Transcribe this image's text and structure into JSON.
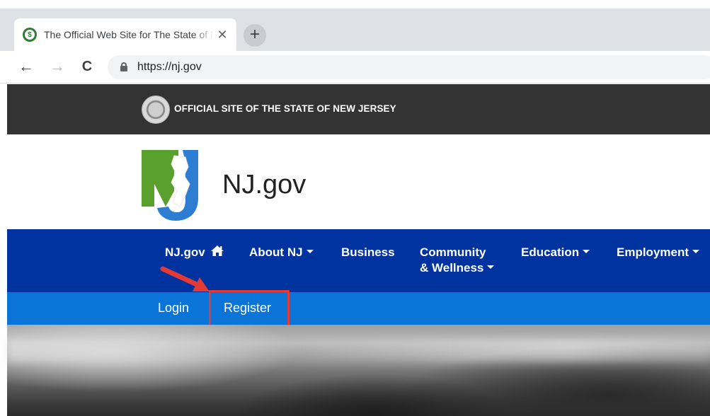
{
  "browser": {
    "tab_title": "The Official Web Site for The State of New Jersey",
    "tab_close": "✕",
    "new_tab": "+",
    "url": "https://nj.gov",
    "back": "←",
    "forward": "→",
    "reload": "C"
  },
  "official_bar": {
    "text": "OFFICIAL SITE OF THE STATE OF NEW JERSEY"
  },
  "header": {
    "brand": "NJ.gov",
    "logo_letters": "NJ"
  },
  "main_nav": {
    "items": [
      {
        "label": "NJ.gov",
        "icon": "home-icon"
      },
      {
        "label": "About NJ",
        "dropdown": true
      },
      {
        "label": "Business"
      },
      {
        "label": "Community",
        "label2": "& Wellness",
        "dropdown": true
      },
      {
        "label": "Education",
        "dropdown": true
      },
      {
        "label": "Employment",
        "dropdown": true
      }
    ]
  },
  "sub_nav": {
    "items": [
      {
        "label": "Login"
      },
      {
        "label": "Register"
      }
    ]
  },
  "colors": {
    "official_bar": "#333333",
    "main_nav": "#0033a0",
    "sub_nav": "#0b74d8",
    "highlight": "#e53935",
    "logo_green": "#5aa02c",
    "logo_blue": "#2d7dd2"
  }
}
